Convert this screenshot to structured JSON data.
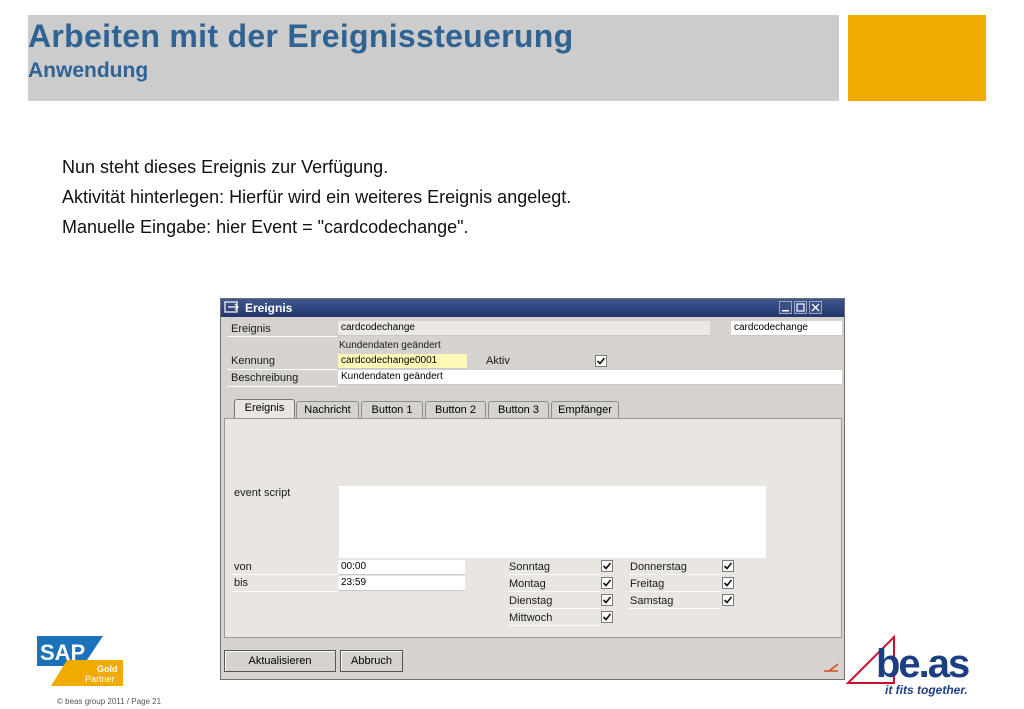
{
  "slide": {
    "title": "Arbeiten mit der Ereignissteuerung",
    "subtitle": "Anwendung",
    "bullets": [
      "Nun steht dieses Ereignis zur Verfügung.",
      "Aktivität hinterlegen: Hierfür wird ein weiteres Ereignis angelegt.",
      "Manuelle Eingabe: hier Event = \"cardcodechange\"."
    ],
    "colors": {
      "title": "#2e6393",
      "header_bar": "#cccccc",
      "accent": "#f0ab00"
    }
  },
  "window": {
    "title": "Ereignis",
    "labels": {
      "ereignis": "Ereignis",
      "kennung": "Kennung",
      "beschreibung": "Beschreibung",
      "aktiv": "Aktiv"
    },
    "values": {
      "ereignis": "cardcodechange",
      "ereignis_right": "cardcodechange",
      "ereignis_sub": "Kundendaten geändert",
      "kennung": "cardcodechange0001",
      "beschreibung": "Kundendaten geändert",
      "aktiv": true
    },
    "tabs": [
      "Ereignis",
      "Nachricht",
      "Button 1",
      "Button 2",
      "Button 3",
      "Empfänger"
    ],
    "active_tab": "Ereignis",
    "panel": {
      "event_script_label": "event script",
      "event_script_value": "",
      "von_label": "von",
      "von_value": "00:00",
      "bis_label": "bis",
      "bis_value": "23:59",
      "days": [
        {
          "label": "Sonntag",
          "checked": true
        },
        {
          "label": "Montag",
          "checked": true
        },
        {
          "label": "Dienstag",
          "checked": true
        },
        {
          "label": "Mittwoch",
          "checked": true
        },
        {
          "label": "Donnerstag",
          "checked": true
        },
        {
          "label": "Freitag",
          "checked": true
        },
        {
          "label": "Samstag",
          "checked": true
        }
      ]
    },
    "buttons": {
      "update": "Aktualisieren",
      "cancel": "Abbruch"
    },
    "icons": [
      "window-icon",
      "minimize-icon",
      "maximize-icon",
      "close-icon",
      "check-icon",
      "resize-corner-icon"
    ]
  },
  "footer": {
    "sap_logo_text": "SAP",
    "sap_badge_line1": "Gold",
    "sap_badge_line2": "Partner",
    "beas_logo_text": "be.as",
    "tagline": "it fits together.",
    "copyright": "© beas group 2011 / Page 21"
  }
}
